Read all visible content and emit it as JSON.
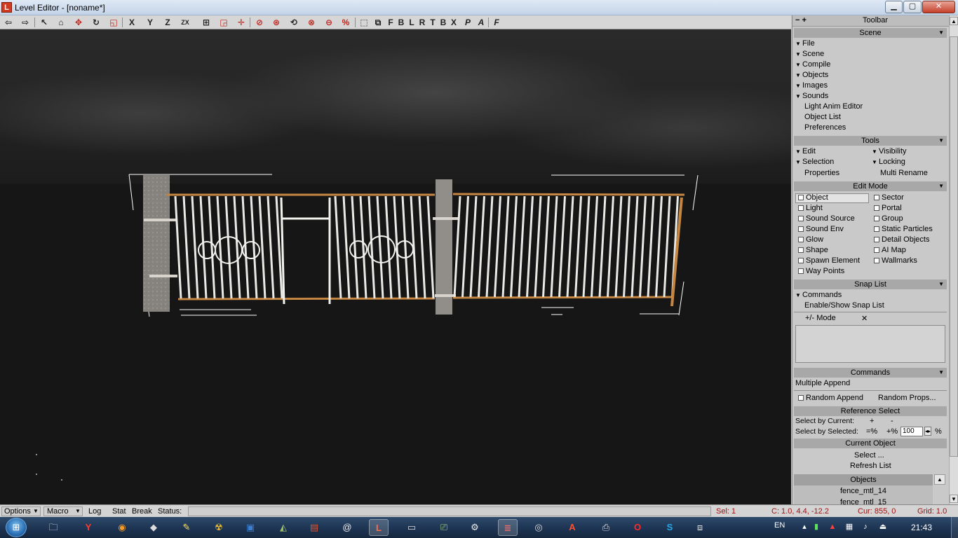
{
  "window": {
    "app_icon": "L",
    "title": "Level Editor - [noname*]",
    "min_label": "▁",
    "max_label": "▢",
    "close_label": "✕"
  },
  "toolbar": {
    "letters": [
      "F",
      "B",
      "L",
      "R",
      "T",
      "B",
      "X"
    ],
    "axes": [
      "X",
      "Y",
      "Z",
      "ZX"
    ]
  },
  "panel": {
    "top_title": "Toolbar",
    "top_icons": "− +",
    "scene": {
      "title": "Scene",
      "items": [
        "File",
        "Scene",
        "Compile",
        "Objects",
        "Images",
        "Sounds"
      ],
      "plain_items": [
        "Light Anim Editor",
        "Object List",
        "Preferences"
      ]
    },
    "tools": {
      "title": "Tools",
      "left": [
        "Edit",
        "Selection"
      ],
      "right": [
        "Visibility",
        "Locking"
      ],
      "properties": "Properties",
      "multi_rename": "Multi Rename"
    },
    "edit_mode": {
      "title": "Edit Mode",
      "left": [
        "Object",
        "Light",
        "Sound Source",
        "Sound Env",
        "Glow",
        "Shape",
        "Spawn Element",
        "Way Points"
      ],
      "right": [
        "Sector",
        "Portal",
        "Group",
        "Static Particles",
        "Detail Objects",
        "AI Map",
        "Wallmarks"
      ]
    },
    "snap_list": {
      "title": "Snap List",
      "commands": "Commands",
      "enable_show": "Enable/Show Snap List",
      "mode_label": "+/-  Mode",
      "clear_icon": "✕"
    },
    "commands": {
      "title": "Commands",
      "multiple_append": "Multiple Append",
      "random_append": "Random Append",
      "random_props": "Random Props..."
    },
    "reference_select": {
      "title": "Reference Select",
      "by_current": "Select by Current:",
      "by_current_plus": "+",
      "by_current_minus": "-",
      "by_selected": "Select by Selected:",
      "eq_pct": "=%",
      "plus_pct": "+%",
      "value": "100",
      "pct": "%"
    },
    "current_object": {
      "title": "Current Object",
      "select": "Select ...",
      "refresh": "Refresh List"
    },
    "objects": {
      "title": "Objects",
      "rows": [
        "fence_mtl_14",
        "fence_mtl_15"
      ]
    }
  },
  "statusbar": {
    "options": "Options",
    "macro": "Macro",
    "log": "Log",
    "stat": "Stat",
    "break": "Break",
    "status": "Status:",
    "sel": "Sel: 1",
    "c": "C: 1.0, 4.4, -12.2",
    "cur": "Cur: 855, 0",
    "grid": "Grid: 1.0"
  },
  "taskbar": {
    "start_glyph": "⊞",
    "lang": "EN",
    "clock": "21:43"
  },
  "colors": {
    "viewport_bg": "#161616",
    "panel_bg": "#c9c9c9",
    "header_bg": "#a8a8a8",
    "status_red": "#a01010",
    "taskbar_bg": "#1c3250"
  }
}
